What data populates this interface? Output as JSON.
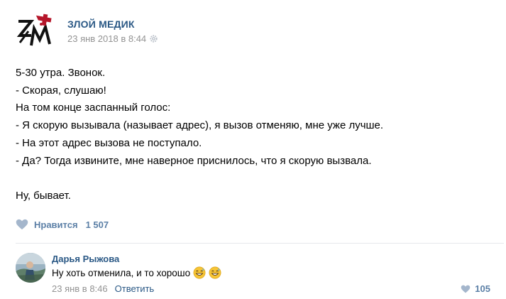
{
  "post": {
    "author": "ЗЛОЙ МЕДИК",
    "date": "23 янв 2018 в 8:44",
    "lines": [
      "5-30 утра. Звонок.",
      "- Скорая, слушаю!",
      "На том конце заспанный голос:",
      "- Я скорую вызывала (называет адрес), я вызов отменяю, мне уже лучше.",
      "- На этот адрес вызова не поступало.",
      "- Да? Тогда извините, мне наверное приснилось, что я скорую вызвала."
    ],
    "closing": "Ну, бывает.",
    "likes_label": "Нравится",
    "likes_count": "1 507"
  },
  "comment": {
    "author": "Дарья Рыжова",
    "text": "Ну хоть отменила, и то хорошо",
    "emojis": [
      "grinning-sweat-emoji",
      "grinning-sweat-emoji"
    ],
    "date": "23 янв в 8:46",
    "reply_label": "Ответить",
    "likes_count": "105"
  },
  "icons": {
    "settings": "gear-icon",
    "like": "heart-icon"
  },
  "colors": {
    "link": "#2a5885",
    "meta": "#939393",
    "like": "#5b7fa6",
    "logo_accent": "#b5162a"
  }
}
